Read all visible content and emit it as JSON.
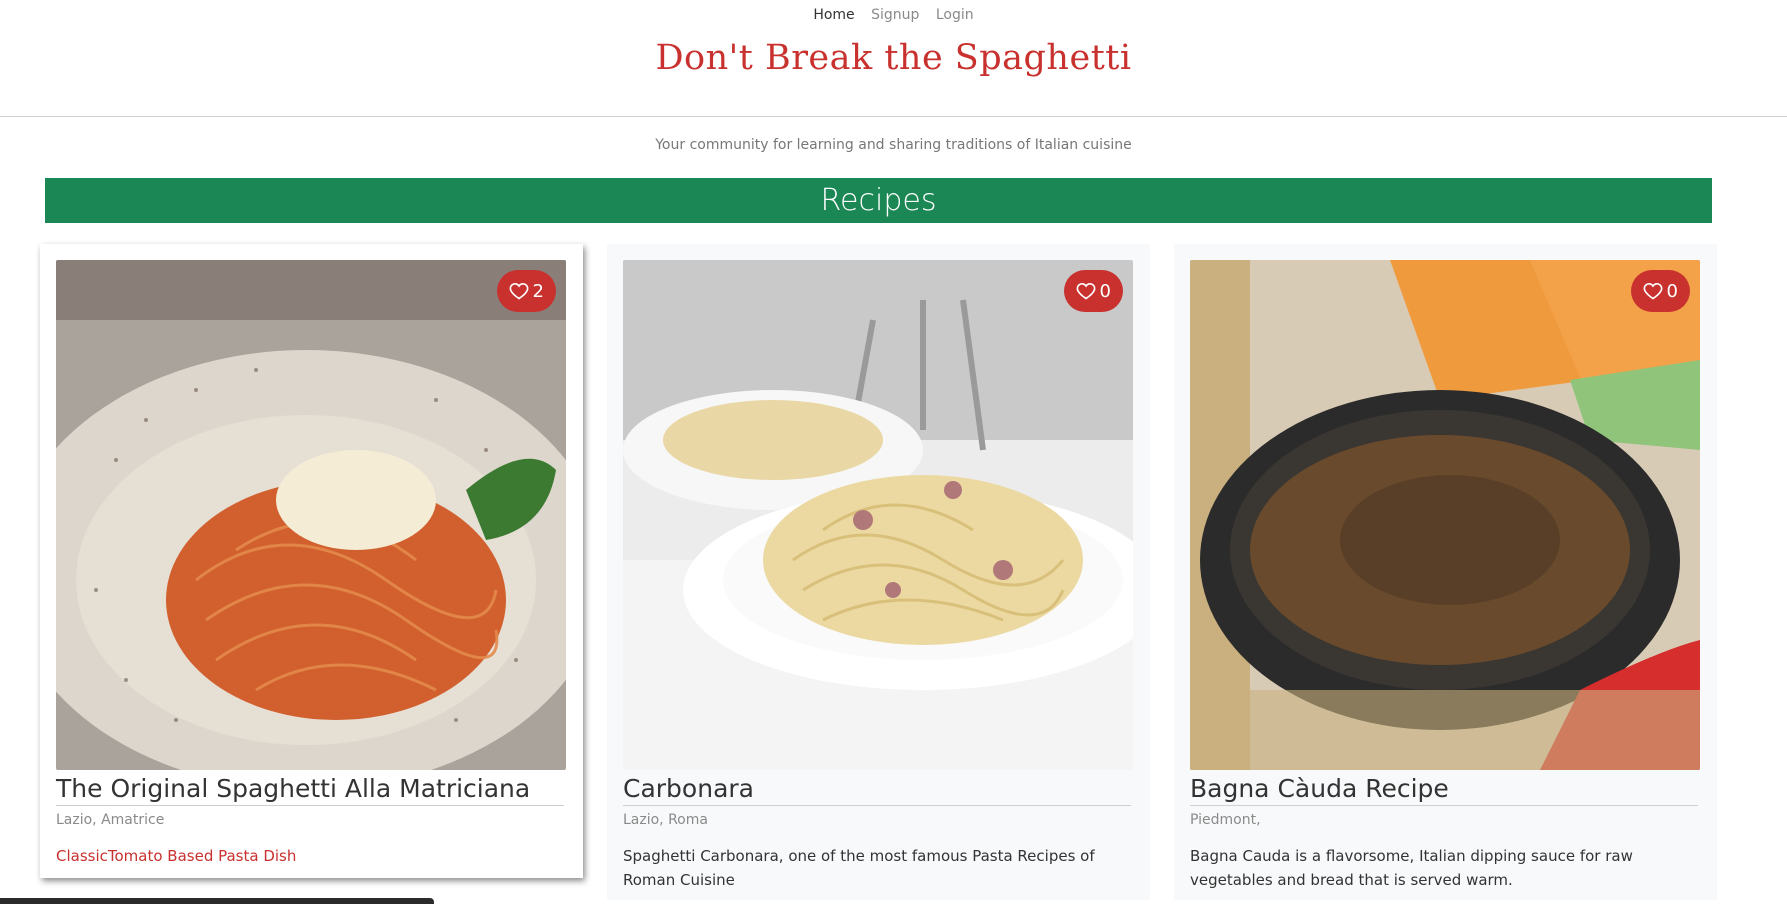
{
  "nav": {
    "home": "Home",
    "signup": "Signup",
    "login": "Login"
  },
  "brand": "Don't Break the Spaghetti",
  "tagline": "Your community for learning and sharing traditions of Italian cuisine",
  "section_title": "Recipes",
  "accent_colors": {
    "brand_red": "#c8312e",
    "section_green": "#1a8754"
  },
  "recipes": [
    {
      "title": "The Original Spaghetti Alla Matriciana",
      "region": "Lazio, Amatrice",
      "description": "ClassicTomato Based Pasta Dish",
      "likes": "2",
      "image": "spaghetti-amatriciana-photo"
    },
    {
      "title": "Carbonara",
      "region": "Lazio, Roma",
      "description": "Spaghetti Carbonara, one of the most famous Pasta Recipes of Roman Cuisine",
      "likes": "0",
      "image": "spaghetti-carbonara-photo"
    },
    {
      "title": "Bagna Càuda Recipe",
      "region": "Piedmont,",
      "description": "Bagna Cauda is a flavorsome, Italian dipping sauce for raw vegetables and bread that is served warm.",
      "likes": "0",
      "image": "bagna-cauda-photo"
    }
  ]
}
